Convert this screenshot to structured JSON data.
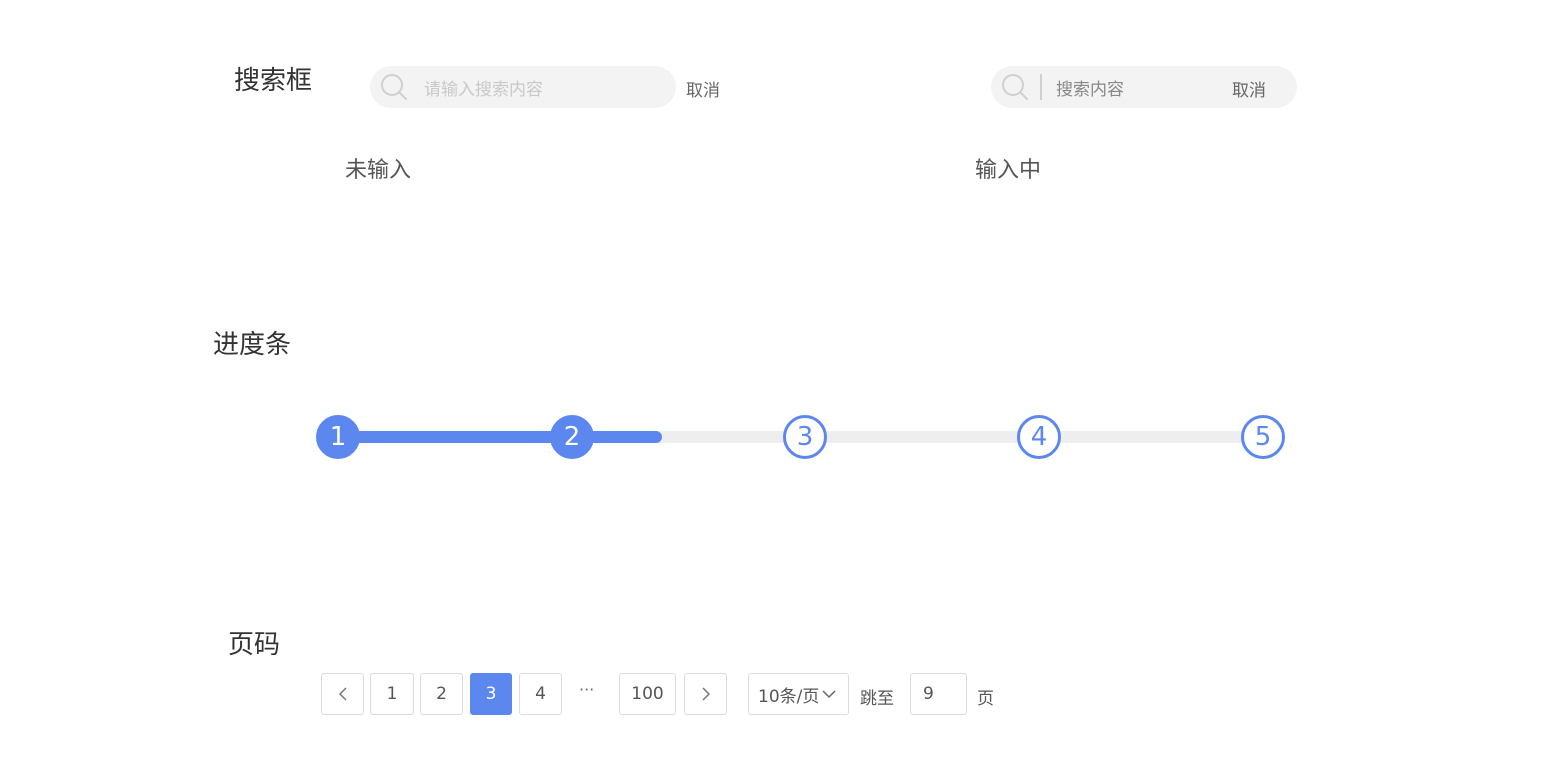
{
  "search": {
    "title": "搜索框",
    "idle": {
      "placeholder": "请输入搜索内容",
      "cancel_label": "取消",
      "caption": "未输入"
    },
    "typing": {
      "value": "搜索内容",
      "cancel_label": "取消",
      "caption": "输入中"
    }
  },
  "progress": {
    "title": "进度条",
    "steps": [
      "1",
      "2",
      "3",
      "4",
      "5"
    ],
    "completed_steps": 2,
    "fill_fraction": 0.35,
    "accent_color": "#5b87ee",
    "track_color": "#eeeeee"
  },
  "pagination": {
    "title": "页码",
    "prev_icon": "chevron-left-icon",
    "next_icon": "chevron-right-icon",
    "pages": [
      "1",
      "2",
      "3",
      "4"
    ],
    "ellipsis": "···",
    "last_page": "100",
    "current_page": "3",
    "page_size": "10条/页",
    "jump_label": "跳至",
    "jump_value": "9",
    "page_suffix": "页"
  }
}
